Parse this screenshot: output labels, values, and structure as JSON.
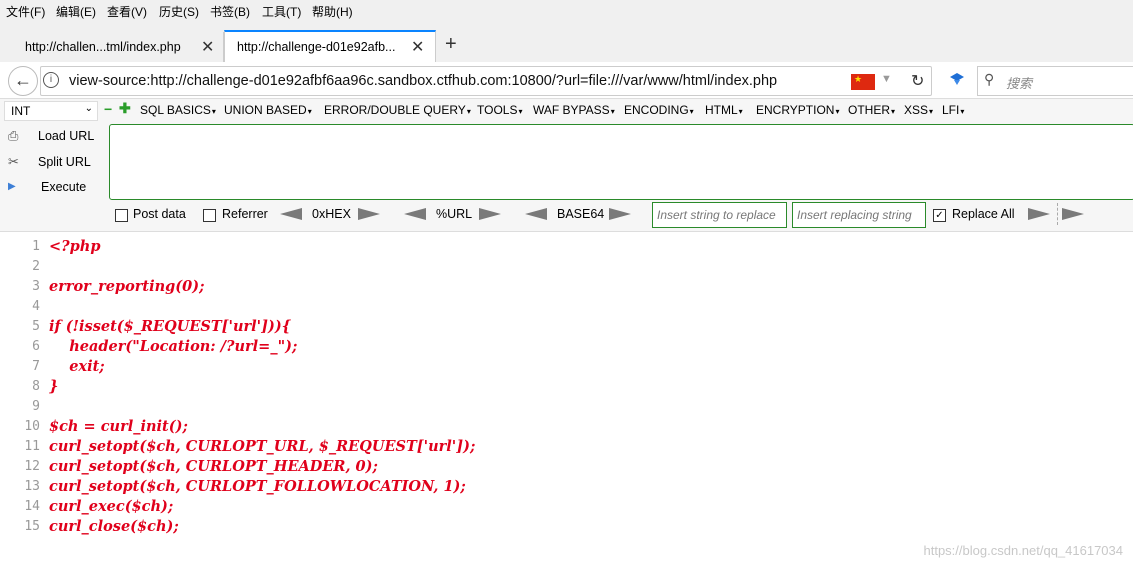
{
  "menubar": [
    "文件(F)",
    "编辑(E)",
    "查看(V)",
    "历史(S)",
    "书签(B)",
    "工具(T)",
    "帮助(H)"
  ],
  "tabs": [
    {
      "title": "http://challen...tml/index.php"
    },
    {
      "title": "http://challenge-d01e92afb..."
    }
  ],
  "tab_close": "✕",
  "new_tab": "+",
  "nav": {
    "url": "view-source:http://challenge-d01e92afbf6aa96c.sandbox.ctfhub.com:10800/?url=file:///var/www/html/index.php",
    "search_placeholder": "搜索",
    "back_glyph": "←",
    "info_glyph": "i",
    "reload_glyph": "↻",
    "search_glyph": "⚲",
    "flag_star": "★",
    "dropdown_glyph": "▼"
  },
  "hackbar": {
    "select_value": "INT",
    "select_caret": "⌄",
    "minus": "−",
    "plus": "✚",
    "menus": [
      "SQL BASICS",
      "UNION BASED",
      "ERROR/DOUBLE QUERY",
      "TOOLS",
      "WAF BYPASS",
      "ENCODING",
      "HTML",
      "ENCRYPTION",
      "OTHER",
      "XSS",
      "LFI"
    ],
    "side": [
      {
        "label": "Load URL",
        "icon": "⎙"
      },
      {
        "label": "Split URL",
        "icon": "✂"
      },
      {
        "label": "Execute",
        "icon": "▶"
      }
    ],
    "post_data": "Post data",
    "referrer": "Referrer",
    "hex": "0xHEX",
    "url_enc": "%URL",
    "base64": "BASE64",
    "insert_placeholder": "Insert string to replace",
    "replacing_placeholder": "Insert replacing string",
    "replace_all": "Replace All",
    "replace_all_checked": true,
    "check_glyph": "✓"
  },
  "code_lines": [
    {
      "n": "1",
      "text": "<?php"
    },
    {
      "n": "2",
      "text": ""
    },
    {
      "n": "3",
      "text": "error_reporting(0);"
    },
    {
      "n": "4",
      "text": ""
    },
    {
      "n": "5",
      "text": "if (!isset($_REQUEST['url'])){"
    },
    {
      "n": "6",
      "text": "    header(\"Location: /?url=_\");"
    },
    {
      "n": "7",
      "text": "    exit;"
    },
    {
      "n": "8",
      "text": "}"
    },
    {
      "n": "9",
      "text": ""
    },
    {
      "n": "10",
      "text": "$ch = curl_init();"
    },
    {
      "n": "11",
      "text": "curl_setopt($ch, CURLOPT_URL, $_REQUEST['url']);"
    },
    {
      "n": "12",
      "text": "curl_setopt($ch, CURLOPT_HEADER, 0);"
    },
    {
      "n": "13",
      "text": "curl_setopt($ch, CURLOPT_FOLLOWLOCATION, 1);"
    },
    {
      "n": "14",
      "text": "curl_exec($ch);"
    },
    {
      "n": "15",
      "text": "curl_close($ch);"
    }
  ],
  "watermark": "https://blog.csdn.net/qq_41617034",
  "colors": {
    "code": "#e0001b",
    "accent": "#0a84ff",
    "hackbar_border": "#2a8a2a"
  }
}
